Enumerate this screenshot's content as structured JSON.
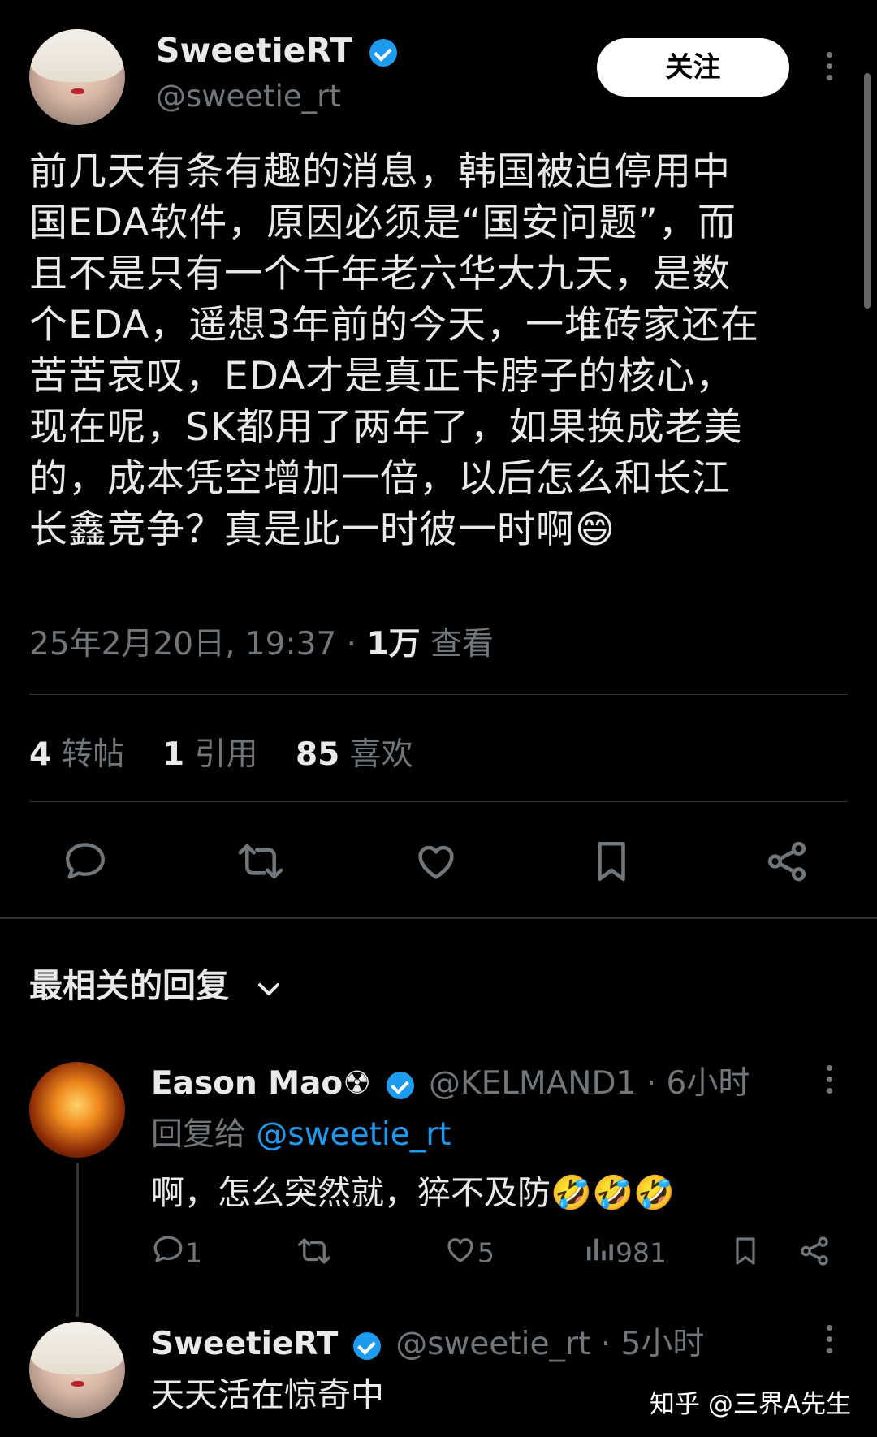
{
  "tweet": {
    "author_name": "SweetieRT",
    "author_handle": "@sweetie_rt",
    "follow_label": "关注",
    "text": "前几天有条有趣的消息，韩国被迫停用中\n国EDA软件，原因必须是“国安问题”，而\n且不是只有一个千年老六华大九天，是数\n个EDA，遥想3年前的今天，一堆砖家还在\n苦苦哀叹，EDA才是真正卡脖子的核心，\n现在呢，SK都用了两年了，如果换成老美\n的，成本凭空增加一倍，以后怎么和长江\n长鑫竞争？真是此一时彼一时啊😄",
    "timestamp": "25年2月20日, 19:37 · ",
    "views_count": "1万",
    "views_label": "查看",
    "stats": {
      "retweets_count": "4",
      "retweets_label": "转帖",
      "quotes_count": "1",
      "quotes_label": "引用",
      "likes_count": "85",
      "likes_label": "喜欢"
    },
    "actions": [
      "reply-icon",
      "retweet-icon",
      "heart-icon",
      "bookmark-icon",
      "share-icon"
    ]
  },
  "replies_header": {
    "label": "最相关的回复"
  },
  "replies": [
    {
      "author_name": "Eason Mao☢",
      "author_handle": "@KELMAND1",
      "time": "· 6小时",
      "reply_to_prefix": "回复给",
      "reply_to_handle": "@sweetie_rt",
      "text": "啊，怎么突然就，猝不及防🤣🤣🤣",
      "reply_count": "1",
      "like_count": "5",
      "view_count": "981"
    },
    {
      "author_name": "SweetieRT",
      "author_handle": "@sweetie_rt",
      "time": "· 5小时",
      "text": "天天活在惊奇中"
    }
  ],
  "watermark": "知乎 @三界A先生",
  "colors": {
    "background": "#000000",
    "text": "#e7e9ea",
    "muted": "#71767b",
    "link": "#1d9bf0",
    "verified": "#1d9bf0"
  }
}
